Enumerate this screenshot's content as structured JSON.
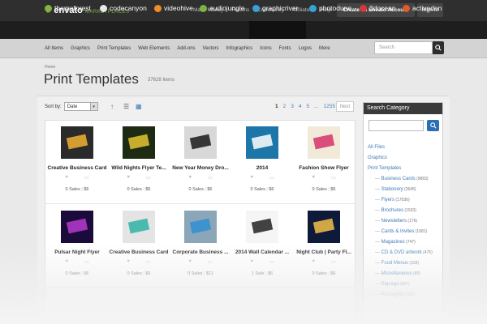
{
  "topbar": {
    "logo_name": "envato",
    "logo_sub": "MARKETPLACES",
    "nav": [
      "Make Money",
      "Forums",
      "Community",
      "Affiliates",
      "Help"
    ],
    "create_account": "Create an Envato Account",
    "sign_in": "Sign In"
  },
  "marketplaces": [
    {
      "label": "themeforest",
      "color": "#82b440"
    },
    {
      "label": "codecanyon",
      "color": "#e8e8e8"
    },
    {
      "label": "videohive",
      "color": "#f08d2a"
    },
    {
      "label": "audiojungle",
      "color": "#7cb342"
    },
    {
      "label": "graphicriver",
      "color": "#3aa0d8"
    },
    {
      "label": "photodune",
      "color": "#33a4d6"
    },
    {
      "label": "3docean",
      "color": "#d63838"
    },
    {
      "label": "activeden",
      "color": "#e05a2a"
    }
  ],
  "categories": [
    "All Items",
    "Graphics",
    "Print Templates",
    "Web Elements",
    "Add-ons",
    "Vectors",
    "Infographics",
    "Icons",
    "Fonts",
    "Logos",
    "More"
  ],
  "search": {
    "placeholder": "Search"
  },
  "breadcrumb": "Home",
  "page": {
    "title": "Print Templates",
    "count": "37628 Items"
  },
  "sort": {
    "label": "Sort by:",
    "value": "Date"
  },
  "pagination": {
    "pages": [
      "1",
      "2",
      "3",
      "4",
      "5",
      "...",
      "1255"
    ],
    "next": "Next"
  },
  "items": [
    {
      "title": "Creative Business Card",
      "sales": "0 Sales",
      "price": "$6",
      "thumb": "#2a2a2a",
      "accent": "#f2b233"
    },
    {
      "title": "Wild Nights Flyer Te...",
      "sales": "0 Sales",
      "price": "$6",
      "thumb": "#1d2b12",
      "accent": "#e6c432"
    },
    {
      "title": "New Year Money Dro...",
      "sales": "0 Sales",
      "price": "$6",
      "thumb": "#d8d8d8",
      "accent": "#1a1a1a"
    },
    {
      "title": "2014",
      "sales": "0 Sales",
      "price": "$6",
      "thumb": "#1d76a8",
      "accent": "#ffffff"
    },
    {
      "title": "Fashion Show Flyer",
      "sales": "0 Sales",
      "price": "$6",
      "thumb": "#f2ead8",
      "accent": "#d6336c"
    },
    {
      "title": "Pulsar Night Flyer",
      "sales": "0 Sales",
      "price": "$6",
      "thumb": "#1b0b3a",
      "accent": "#b83ad1"
    },
    {
      "title": "Creative Business Card",
      "sales": "0 Sales",
      "price": "$6",
      "thumb": "#e4e4e4",
      "accent": "#2fb3a6"
    },
    {
      "title": "Corporate Business ...",
      "sales": "0 Sales",
      "price": "$11",
      "thumb": "#8aa6b8",
      "accent": "#2e8fd1"
    },
    {
      "title": "2014 Wall Calendar ...",
      "sales": "1 Sale",
      "price": "$6",
      "thumb": "#f5f5f5",
      "accent": "#222222"
    },
    {
      "title": "Night Club | Party Fl...",
      "sales": "0 Sales",
      "price": "$6",
      "thumb": "#0e1a3a",
      "accent": "#f3c04a"
    }
  ],
  "sidebar": {
    "heading": "Search Category",
    "items": [
      {
        "label": "All Files",
        "count": "",
        "sub": false
      },
      {
        "label": "Graphics",
        "count": "",
        "sub": false
      },
      {
        "label": "Print Templates",
        "count": "",
        "sub": false
      },
      {
        "label": "Business Cards",
        "count": "(9883)",
        "sub": true
      },
      {
        "label": "Stationery",
        "count": "(2645)",
        "sub": true
      },
      {
        "label": "Flyers",
        "count": "(17036)",
        "sub": true
      },
      {
        "label": "Brochures",
        "count": "(1533)",
        "sub": true
      },
      {
        "label": "Newsletters",
        "count": "(176)",
        "sub": true
      },
      {
        "label": "Cards & Invites",
        "count": "(1081)",
        "sub": true
      },
      {
        "label": "Magazines",
        "count": "(747)",
        "sub": true
      },
      {
        "label": "CD & DVD artwork",
        "count": "(475)",
        "sub": true
      },
      {
        "label": "Food Menus",
        "count": "(333)",
        "sub": true
      },
      {
        "label": "Miscellaneous",
        "count": "(85)",
        "sub": true
      },
      {
        "label": "Signage",
        "count": "(807)",
        "sub": true
      },
      {
        "label": "Packaging",
        "count": "(153)",
        "sub": true
      }
    ]
  }
}
